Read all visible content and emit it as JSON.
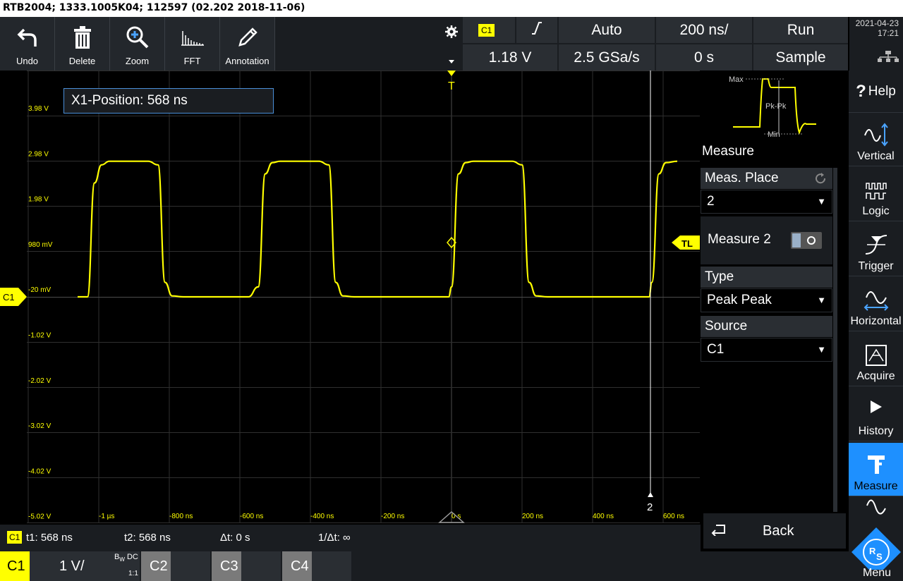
{
  "window": {
    "title": "RTB2004; 1333.1005K04; 112597 (02.202 2018-11-06)"
  },
  "toolbar": {
    "undo": "Undo",
    "delete": "Delete",
    "zoom": "Zoom",
    "fft": "FFT",
    "annotation": "Annotation"
  },
  "status": {
    "channel": "C1",
    "trigger_slope_icon": "rising-edge-icon",
    "trigger_mode": "Auto",
    "timebase": "200 ns/",
    "run_state": "Run",
    "trigger_level": "1.18 V",
    "sample_rate": "2.5 GSa/s",
    "position": "0 s",
    "acq_mode": "Sample"
  },
  "datetime": {
    "date": "2021-04-23",
    "time": "17:21"
  },
  "plot": {
    "tooltip": "X1-Position: 568 ns",
    "y_labels": [
      "3.98 V",
      "2.98 V",
      "1.98 V",
      "980 mV",
      "-20 mV",
      "-1.02 V",
      "-2.02 V",
      "-3.02 V",
      "-4.02 V",
      "-5.02 V"
    ],
    "x_labels": [
      "-1 µs",
      "-800 ns",
      "-600 ns",
      "-400 ns",
      "-200 ns",
      "0 s",
      "200 ns",
      "400 ns",
      "600 ns"
    ],
    "channel_marker": "C1",
    "trigger_marker": "T",
    "trigger_level_marker": "TL",
    "cursor_label": "2",
    "trace_color": "#ffff00"
  },
  "chart_data": {
    "type": "line",
    "series": [
      {
        "name": "C1",
        "x": [
          -1060,
          -1032,
          -1012,
          -992,
          -970,
          -860,
          -832,
          -812,
          -792,
          -760,
          -576,
          -548,
          -528,
          -508,
          -486,
          -376,
          -348,
          -328,
          -308,
          -276,
          -8,
          0,
          20,
          40,
          62,
          172,
          200,
          220,
          240,
          272,
          560,
          568,
          588,
          608,
          640
        ],
        "values": [
          -0.02,
          -0.02,
          2.5,
          2.9,
          2.98,
          2.98,
          2.9,
          0.3,
          0.0,
          -0.02,
          -0.02,
          0.2,
          2.7,
          2.95,
          2.98,
          2.98,
          2.9,
          0.3,
          0.0,
          -0.02,
          -0.02,
          0.2,
          2.7,
          2.95,
          2.98,
          2.98,
          2.9,
          0.3,
          0.0,
          -0.02,
          -0.02,
          0.3,
          2.7,
          2.95,
          2.98
        ]
      }
    ],
    "xlim": [
      -1080,
      700
    ],
    "ylim": [
      -5.02,
      4.98
    ],
    "grid": true
  },
  "panel": {
    "thumb_max": "Max",
    "thumb_pkpk": "Pk-Pk",
    "thumb_min": "Min",
    "title": "Measure",
    "meas_place_label": "Meas. Place",
    "meas_place_value": "2",
    "measure_toggle_label": "Measure 2",
    "type_label": "Type",
    "type_value": "Peak Peak",
    "source_label": "Source",
    "source_value": "C1",
    "back": "Back"
  },
  "menu": {
    "help": "Help",
    "vertical": "Vertical",
    "logic": "Logic",
    "trigger": "Trigger",
    "horizontal": "Horizontal",
    "acquire": "Acquire",
    "history": "History",
    "measure": "Measure",
    "menu": "Menu"
  },
  "cursor": {
    "channel": "C1",
    "t1": "t1: 568 ns",
    "t2": "t2: 568 ns",
    "dt": "Δt: 0 s",
    "inv_dt": "1/Δt: ∞"
  },
  "channels": {
    "c1": "C1",
    "c1_scale": "1 V/",
    "c1_bw": "B",
    "c1_bw_sub": "W",
    "c1_coupling": "DC",
    "c1_ratio": "1:1",
    "c2": "C2",
    "c3": "C3",
    "c4": "C4"
  }
}
